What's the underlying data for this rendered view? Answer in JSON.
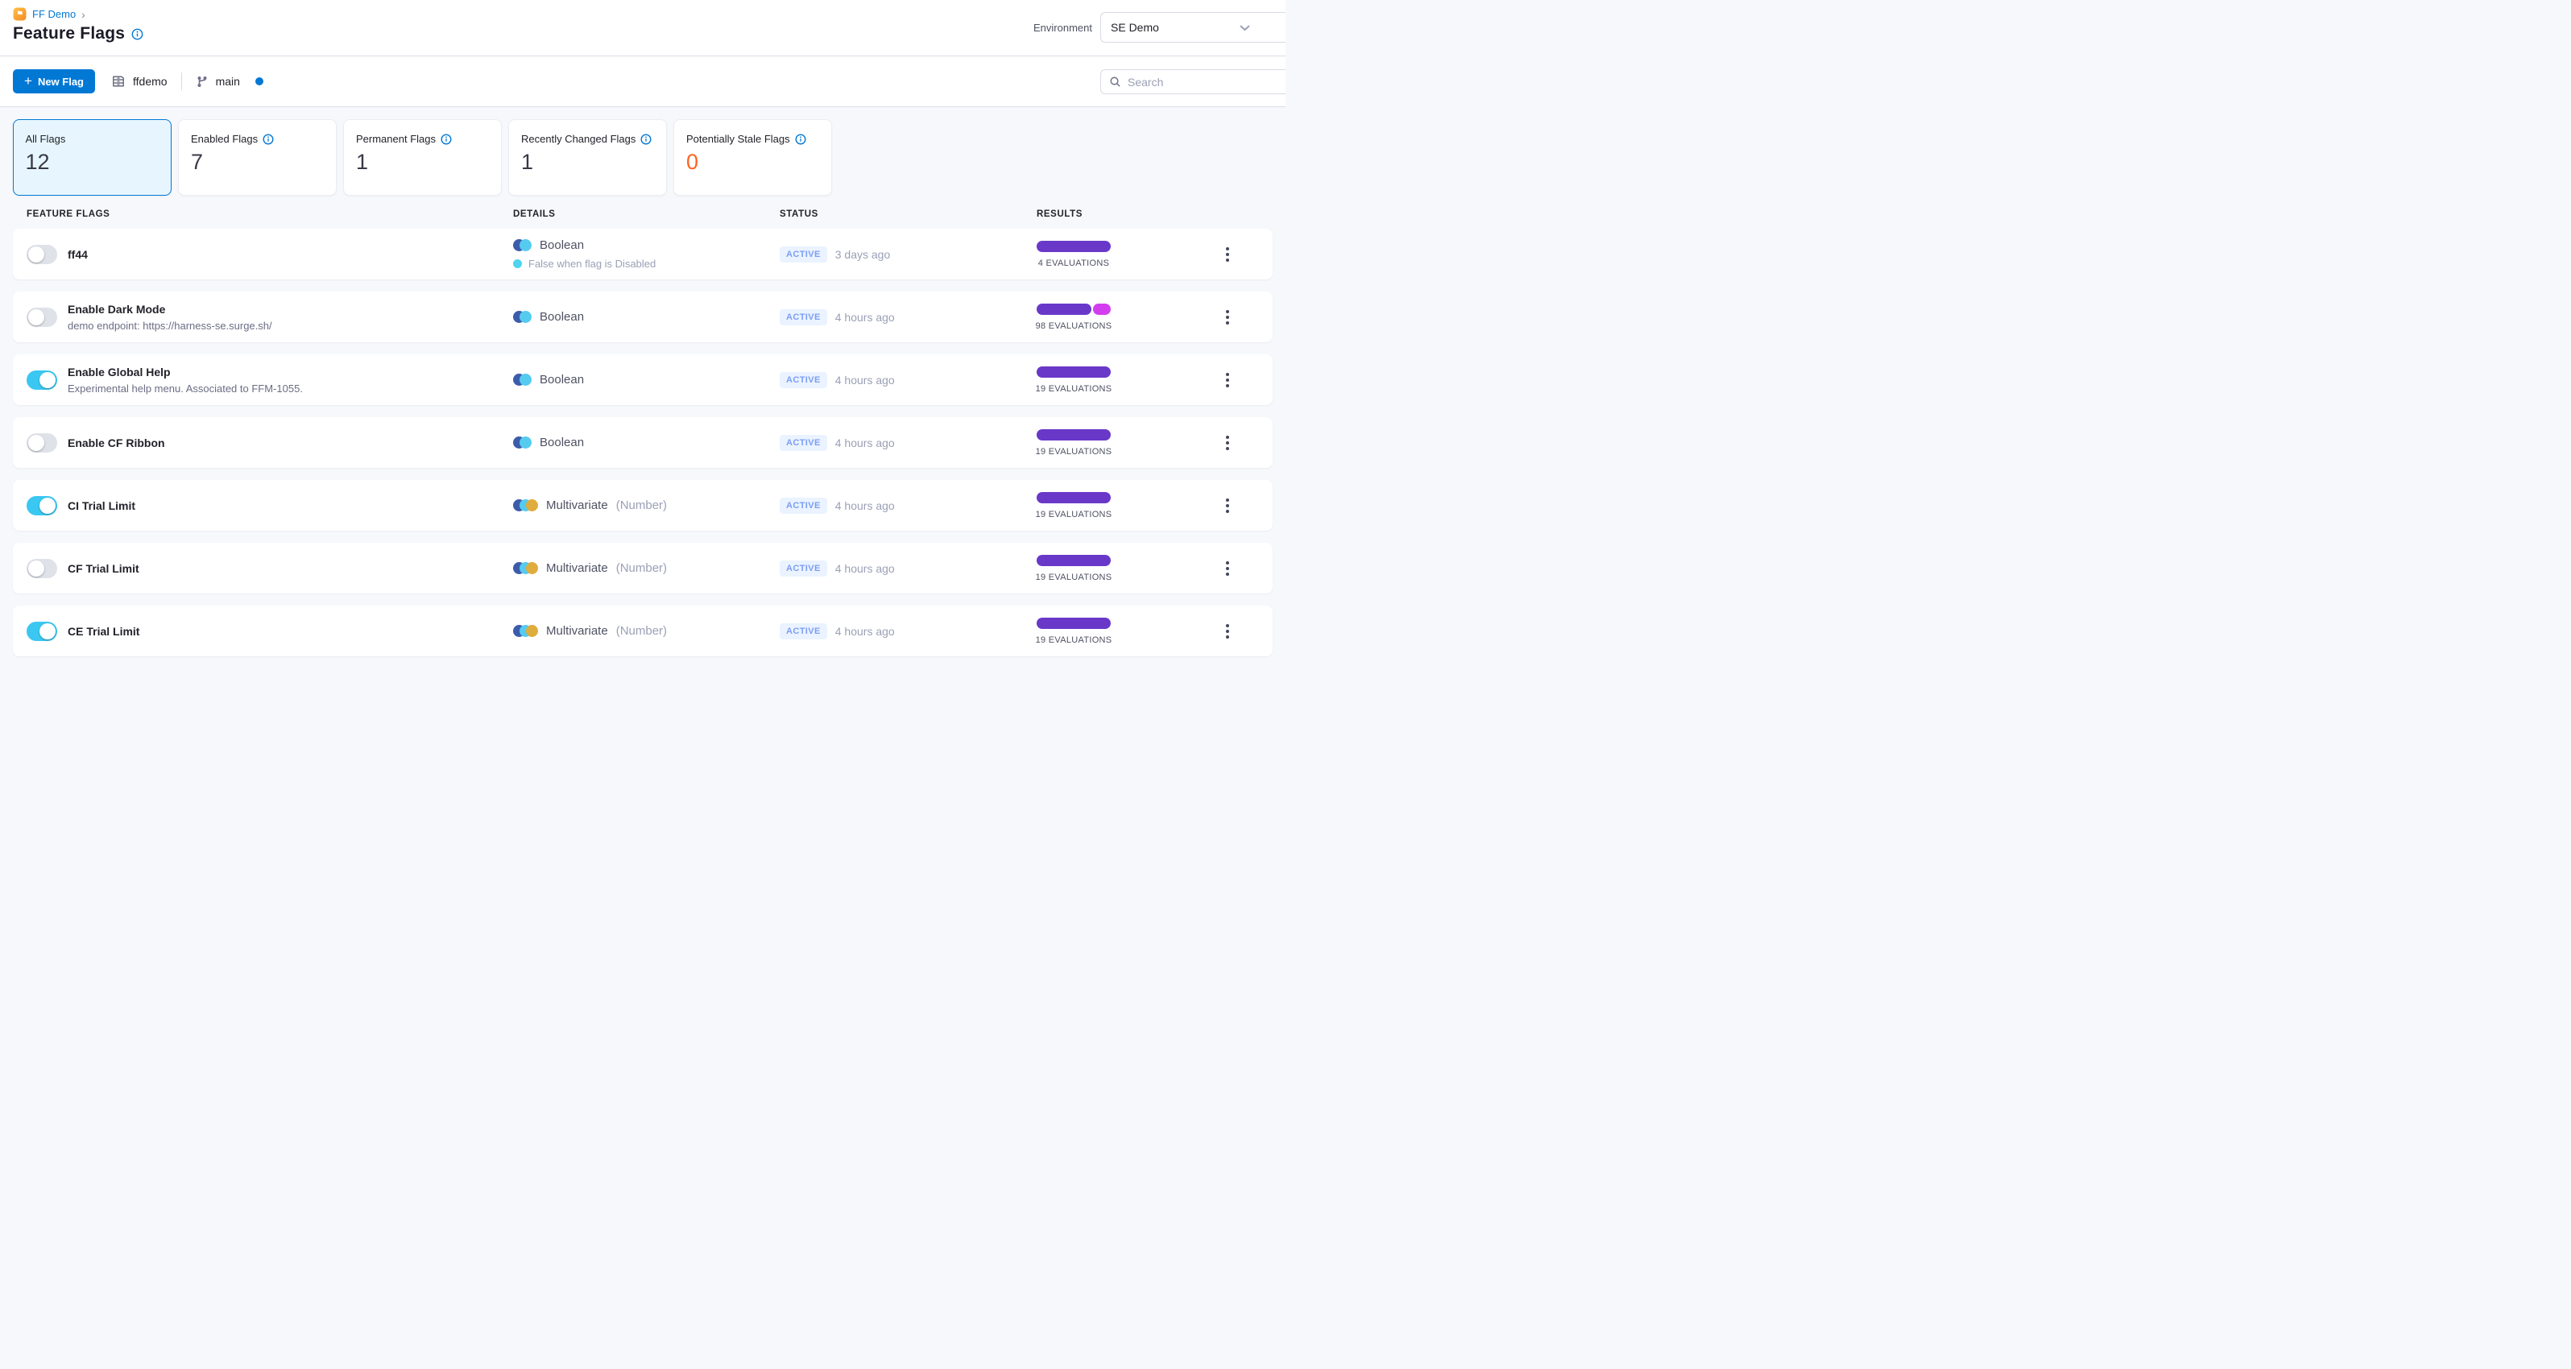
{
  "breadcrumb": {
    "project": "FF Demo",
    "separator": "›"
  },
  "page": {
    "title": "Feature Flags"
  },
  "environment": {
    "label": "Environment",
    "selected": "SE Demo"
  },
  "toolbar": {
    "new_flag_label": "New Flag",
    "plus": "+",
    "repo": "ffdemo",
    "branch": "main"
  },
  "search": {
    "placeholder": "Search"
  },
  "summary_cards": [
    {
      "label": "All Flags",
      "value": "12",
      "info": false,
      "selected": true,
      "value_color": "#383946"
    },
    {
      "label": "Enabled Flags",
      "value": "7",
      "info": true,
      "selected": false,
      "value_color": "#383946"
    },
    {
      "label": "Permanent Flags",
      "value": "1",
      "info": true,
      "selected": false,
      "value_color": "#383946"
    },
    {
      "label": "Recently Changed Flags",
      "value": "1",
      "info": true,
      "selected": false,
      "value_color": "#383946"
    },
    {
      "label": "Potentially Stale Flags",
      "value": "0",
      "info": true,
      "selected": false,
      "value_color": "#FF6421"
    }
  ],
  "table": {
    "headers": [
      "FEATURE FLAGS",
      "DETAILS",
      "STATUS",
      "RESULTS"
    ]
  },
  "rows": [
    {
      "name": "ff44",
      "description": "",
      "enabled": false,
      "type_variant": "boolean",
      "type": "Boolean",
      "type_note": "",
      "subtext": "False when flag is Disabled",
      "status": "ACTIVE",
      "updated": "3 days ago",
      "evaluations": "4 EVALUATIONS",
      "bar": [
        {
          "color": "#6938C9",
          "percent": 100
        }
      ]
    },
    {
      "name": "Enable Dark Mode",
      "description": "demo endpoint: https://harness-se.surge.sh/",
      "enabled": false,
      "type_variant": "boolean",
      "type": "Boolean",
      "type_note": "",
      "subtext": "",
      "status": "ACTIVE",
      "updated": "4 hours ago",
      "evaluations": "98 EVALUATIONS",
      "bar": [
        {
          "color": "#6938C9",
          "percent": 76
        },
        {
          "color": "#D33DF0",
          "percent": 24
        }
      ]
    },
    {
      "name": "Enable Global Help",
      "description": "Experimental help menu. Associated to FFM-1055.",
      "enabled": true,
      "type_variant": "boolean",
      "type": "Boolean",
      "type_note": "",
      "subtext": "",
      "status": "ACTIVE",
      "updated": "4 hours ago",
      "evaluations": "19 EVALUATIONS",
      "bar": [
        {
          "color": "#6938C9",
          "percent": 100
        }
      ]
    },
    {
      "name": "Enable CF Ribbon",
      "description": "",
      "enabled": false,
      "type_variant": "boolean",
      "type": "Boolean",
      "type_note": "",
      "subtext": "",
      "status": "ACTIVE",
      "updated": "4 hours ago",
      "evaluations": "19 EVALUATIONS",
      "bar": [
        {
          "color": "#6938C9",
          "percent": 100
        }
      ]
    },
    {
      "name": "CI Trial Limit",
      "description": "",
      "enabled": true,
      "type_variant": "multivariate",
      "type": "Multivariate",
      "type_note": "(Number)",
      "subtext": "",
      "status": "ACTIVE",
      "updated": "4 hours ago",
      "evaluations": "19 EVALUATIONS",
      "bar": [
        {
          "color": "#6938C9",
          "percent": 100
        }
      ]
    },
    {
      "name": "CF Trial Limit",
      "description": "",
      "enabled": false,
      "type_variant": "multivariate",
      "type": "Multivariate",
      "type_note": "(Number)",
      "subtext": "",
      "status": "ACTIVE",
      "updated": "4 hours ago",
      "evaluations": "19 EVALUATIONS",
      "bar": [
        {
          "color": "#6938C9",
          "percent": 100
        }
      ]
    },
    {
      "name": "CE Trial Limit",
      "description": "",
      "enabled": true,
      "type_variant": "multivariate",
      "type": "Multivariate",
      "type_note": "(Number)",
      "subtext": "",
      "status": "ACTIVE",
      "updated": "4 hours ago",
      "evaluations": "19 EVALUATIONS",
      "bar": [
        {
          "color": "#6938C9",
          "percent": 100
        }
      ]
    }
  ],
  "colors": {
    "primary_blue": "#0278D5",
    "toggle_on_cyan": "#3AC7F2",
    "bar_purple": "#6938C9",
    "bar_magenta": "#D33DF0",
    "stale_orange": "#FF6421",
    "active_badge_bg": "#EAF3FF",
    "active_badge_text": "#7D9EF5"
  }
}
